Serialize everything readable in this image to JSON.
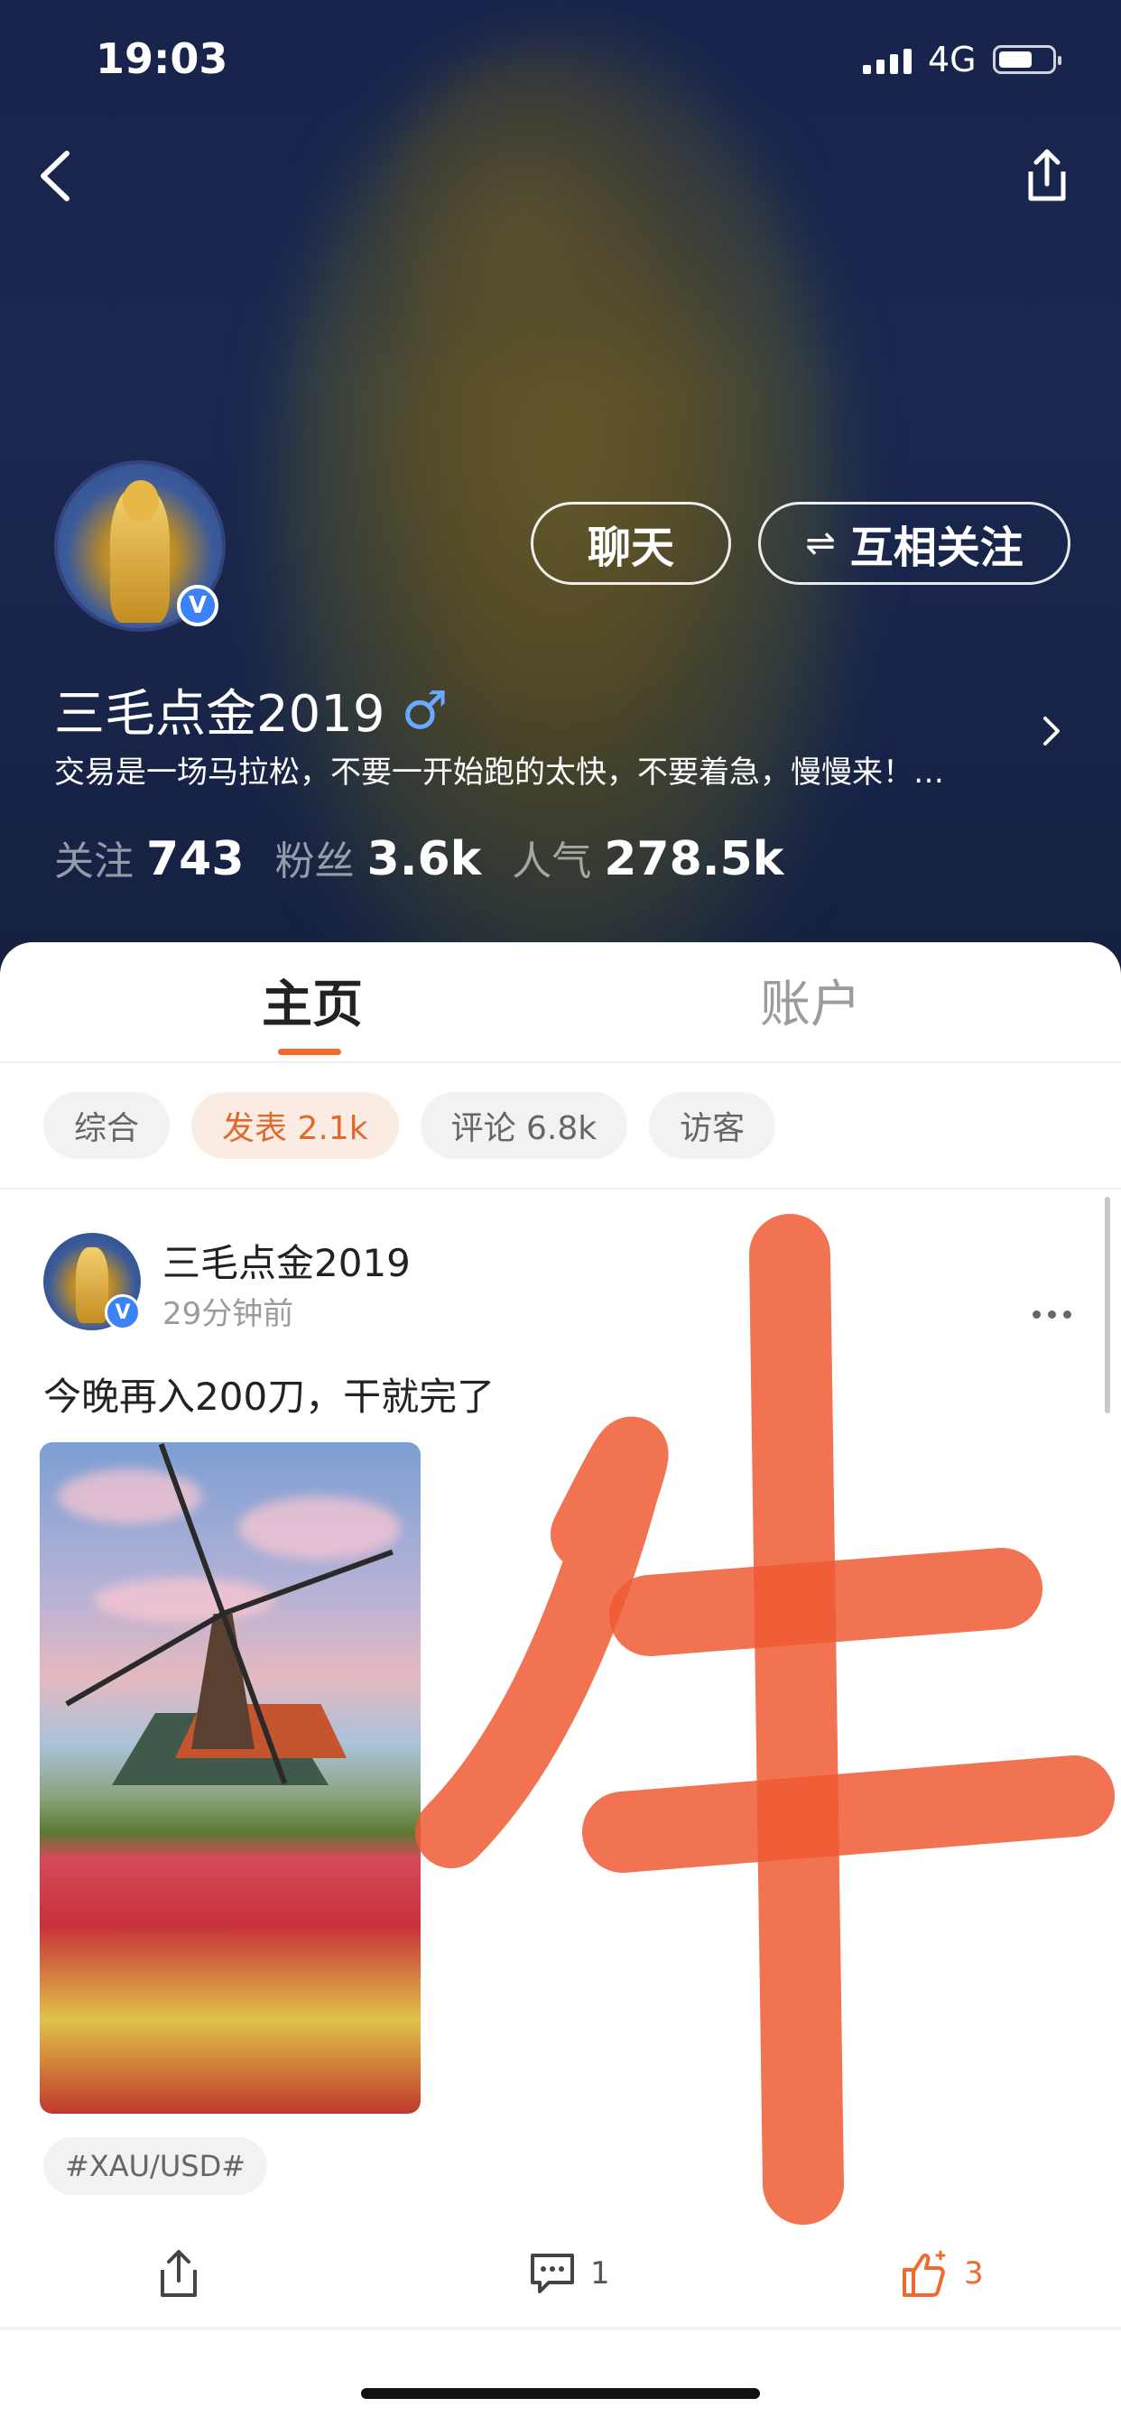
{
  "status_bar": {
    "time": "19:03",
    "network": "4G"
  },
  "profile": {
    "name": "三毛点金2019",
    "gender_symbol": "♂",
    "bio": "交易是一场马拉松，不要一开始跑的太快，不要着急，慢慢来！…",
    "verified_badge": "V",
    "stats": [
      {
        "label": "关注",
        "value": "743"
      },
      {
        "label": "粉丝",
        "value": "3.6k"
      },
      {
        "label": "人气",
        "value": "278.5k"
      }
    ],
    "chat_label": "聊天",
    "follow_label": "互相关注",
    "follow_icon": "⇌"
  },
  "tabs": [
    {
      "label": "主页",
      "active": true
    },
    {
      "label": "账户",
      "active": false
    }
  ],
  "filters": [
    {
      "label": "综合",
      "active": false
    },
    {
      "label": "发表 2.1k",
      "active": true
    },
    {
      "label": "评论 6.8k",
      "active": false
    },
    {
      "label": "访客",
      "active": false
    }
  ],
  "post": {
    "author": "三毛点金2019",
    "time": "29分钟前",
    "text": "今晚再入200刀，干就完了",
    "hashtag": "#XAU/USD#",
    "comment_count": "1",
    "like_count": "3"
  },
  "overlay": {
    "handwritten_char": "牛",
    "color": "#ee5a32"
  },
  "colors": {
    "accent": "#f2692c",
    "header_bg": "#1c2a52",
    "verified": "#3b82f6"
  }
}
